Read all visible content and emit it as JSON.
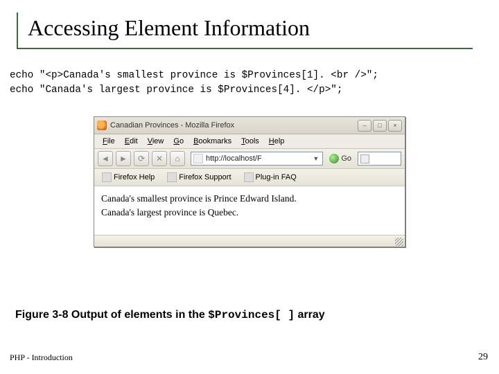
{
  "title": "Accessing Element Information",
  "code_line1": "echo \"<p>Canada's smallest province is $Provinces[1]. <br />\";",
  "code_line2": "echo \"Canada's largest province is $Provinces[4]. </p>\";",
  "browser": {
    "window_title": "Canadian Provinces - Mozilla Firefox",
    "menu": {
      "file": "File",
      "edit": "Edit",
      "view": "View",
      "go": "Go",
      "bookmarks": "Bookmarks",
      "tools": "Tools",
      "help": "Help"
    },
    "address": "http://localhost/F",
    "go_label": "Go",
    "links": {
      "help": "Firefox Help",
      "support": "Firefox Support",
      "plugin": "Plug-in FAQ"
    },
    "content_line1": "Canada's smallest province is Prince Edward Island.",
    "content_line2": "Canada's largest province is Quebec."
  },
  "caption_prefix": "Figure 3-8   Output of elements in the ",
  "caption_code": "$Provinces[ ]",
  "caption_suffix": " array",
  "footer_left": "PHP - Introduction",
  "footer_right": "29"
}
